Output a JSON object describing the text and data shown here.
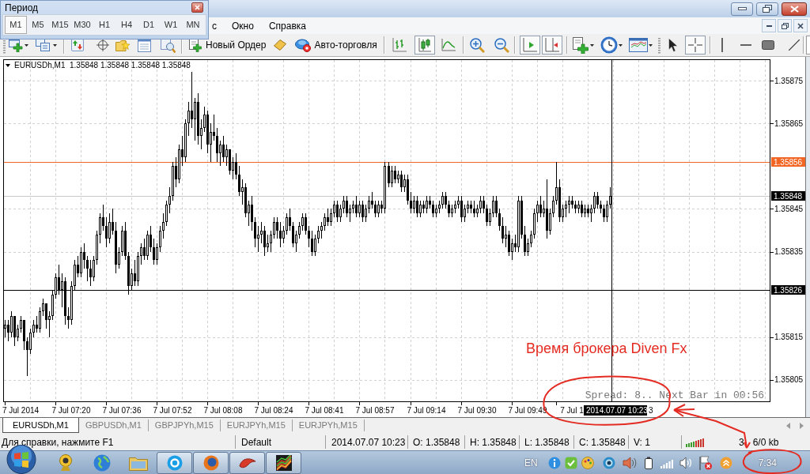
{
  "period_popup": {
    "title": "Период",
    "periods": [
      {
        "label": "M1",
        "selected": true
      },
      {
        "label": "M5",
        "selected": false
      },
      {
        "label": "M15",
        "selected": false
      },
      {
        "label": "M30",
        "selected": false
      },
      {
        "label": "H1",
        "selected": false
      },
      {
        "label": "H4",
        "selected": false
      },
      {
        "label": "D1",
        "selected": false
      },
      {
        "label": "W1",
        "selected": false
      },
      {
        "label": "MN",
        "selected": false
      }
    ]
  },
  "menu": {
    "items": [
      "с",
      "Окно",
      "Справка"
    ]
  },
  "toolbar": {
    "order_button": "Новый Ордер",
    "autotrade_button": "Авто-торговля",
    "chart_types": [
      {
        "selected": false
      },
      {
        "selected": true
      },
      {
        "selected": false
      }
    ],
    "auto_scroll": {
      "on": true
    },
    "chart_shift": {
      "on": true
    },
    "cursor_modes": [
      {
        "selected": false
      },
      {
        "selected": true
      }
    ]
  },
  "chart": {
    "chart_data": [
      {
        "type": "candlestick",
        "title": "EURUSDh,M1",
        "subtitle": "1.35848 1.35848 1.35848 1.35848",
        "categories": [
          null,
          null,
          null,
          null,
          null,
          "7 Jul 2014",
          null,
          null,
          null,
          null,
          null,
          null,
          null,
          null,
          null,
          null,
          null,
          null,
          null,
          null,
          null,
          "7 Jul 07:20",
          null,
          null,
          null,
          null,
          null,
          null,
          null,
          null,
          null,
          null,
          null,
          null,
          null,
          null,
          null,
          "7 Jul 07:36",
          null,
          null,
          null,
          null,
          null,
          null,
          null,
          null,
          null,
          null,
          null,
          null,
          null,
          null,
          null,
          "7 Jul 07:52",
          null,
          null,
          null,
          null,
          null,
          null,
          null,
          null,
          null,
          null,
          null,
          null,
          null,
          null,
          null,
          "7 Jul 08:08",
          null,
          null,
          null,
          null,
          null,
          null,
          null,
          null,
          null,
          null,
          null,
          null,
          null,
          null,
          null,
          "7 Jul 08:24",
          null,
          null,
          null,
          null,
          null,
          null,
          null,
          null,
          null,
          null,
          null,
          null,
          null,
          null,
          null,
          "7 Jul 08:41",
          null,
          null,
          null,
          null,
          null,
          null,
          null,
          null,
          null,
          null,
          null,
          null,
          null,
          null,
          null,
          "7 Jul 08:57",
          null,
          null,
          null,
          null,
          null,
          null,
          null,
          null,
          null,
          null,
          null,
          null,
          null,
          null,
          null,
          "7 Jul 09:14",
          null,
          null,
          null,
          null,
          null,
          null,
          null,
          null,
          null,
          null,
          null,
          null,
          null,
          null,
          null,
          "7 Jul 09:30",
          null,
          null,
          null,
          null,
          null,
          null,
          null,
          null,
          null,
          null,
          null,
          null,
          null,
          null,
          null,
          "7 Jul 09:49",
          null,
          null,
          null,
          null,
          null,
          null,
          null,
          null,
          null,
          null,
          null,
          null,
          null,
          "7 Jul 1",
          null,
          null,
          null,
          null,
          null,
          null,
          null,
          null,
          null,
          null,
          null,
          null,
          null,
          null,
          null,
          null,
          null,
          null,
          null,
          null,
          null,
          null,
          null,
          null,
          null,
          null,
          null,
          null,
          null,
          null,
          null,
          null,
          null,
          null,
          null,
          null,
          null,
          null,
          null,
          null,
          null,
          null,
          null,
          null,
          null,
          null,
          null,
          null,
          null,
          null,
          null,
          null,
          null,
          null,
          null,
          null,
          null,
          null,
          null,
          null,
          null,
          null
        ],
        "ohlc": [
          [
            1.35817,
            1.35819,
            1.35815,
            1.35818
          ],
          [
            1.35818,
            1.35819,
            1.35814,
            1.35816
          ],
          [
            1.35816,
            1.35821,
            1.35815,
            1.3582
          ],
          [
            1.3582,
            1.3582,
            1.35813,
            1.35815
          ],
          [
            1.35815,
            1.35818,
            1.35814,
            1.35817
          ],
          [
            1.35817,
            1.3582,
            1.35816,
            1.35819
          ],
          [
            1.35819,
            1.35819,
            1.35812,
            1.35814
          ],
          [
            1.35814,
            1.35815,
            1.35806,
            1.35812
          ],
          [
            1.35812,
            1.35817,
            1.35811,
            1.35816
          ],
          [
            1.35816,
            1.35819,
            1.35815,
            1.35818
          ],
          [
            1.35818,
            1.3582,
            1.35816,
            1.35817
          ],
          [
            1.35817,
            1.35822,
            1.35816,
            1.35821
          ],
          [
            1.35821,
            1.35824,
            1.3582,
            1.35823
          ],
          [
            1.35823,
            1.35823,
            1.35817,
            1.35819
          ],
          [
            1.35819,
            1.35821,
            1.35815,
            1.3582
          ],
          [
            1.3582,
            1.35826,
            1.35819,
            1.35825
          ],
          [
            1.35825,
            1.3583,
            1.35824,
            1.35829
          ],
          [
            1.35829,
            1.35832,
            1.35825,
            1.35826
          ],
          [
            1.35826,
            1.3583,
            1.35822,
            1.35828
          ],
          [
            1.35828,
            1.35829,
            1.35818,
            1.3582
          ],
          [
            1.3582,
            1.35822,
            1.35817,
            1.35819
          ],
          [
            1.35819,
            1.35828,
            1.35818,
            1.35827
          ],
          [
            1.35827,
            1.35833,
            1.35826,
            1.35832
          ],
          [
            1.35832,
            1.35834,
            1.35829,
            1.3583
          ],
          [
            1.3583,
            1.35836,
            1.35829,
            1.35835
          ],
          [
            1.35835,
            1.35837,
            1.35831,
            1.35833
          ],
          [
            1.35833,
            1.35834,
            1.35828,
            1.35831
          ],
          [
            1.35831,
            1.35833,
            1.35827,
            1.35829
          ],
          [
            1.35829,
            1.35834,
            1.35828,
            1.35833
          ],
          [
            1.35833,
            1.3584,
            1.35832,
            1.35839
          ],
          [
            1.35839,
            1.35844,
            1.35837,
            1.35843
          ],
          [
            1.35843,
            1.35846,
            1.3584,
            1.35841
          ],
          [
            1.35841,
            1.35843,
            1.35836,
            1.35838
          ],
          [
            1.35838,
            1.35844,
            1.35837,
            1.35842
          ],
          [
            1.35842,
            1.35845,
            1.35839,
            1.3584
          ],
          [
            1.3584,
            1.35842,
            1.3583,
            1.35832
          ],
          [
            1.35832,
            1.35836,
            1.35831,
            1.35835
          ],
          [
            1.35835,
            1.35841,
            1.35834,
            1.3584
          ],
          [
            1.3584,
            1.35842,
            1.35833,
            1.35834
          ],
          [
            1.35834,
            1.35835,
            1.35825,
            1.35827
          ],
          [
            1.35827,
            1.35831,
            1.35826,
            1.3583
          ],
          [
            1.3583,
            1.35833,
            1.35827,
            1.35828
          ],
          [
            1.35828,
            1.35835,
            1.35827,
            1.35834
          ],
          [
            1.35834,
            1.35837,
            1.35832,
            1.35836
          ],
          [
            1.35836,
            1.35838,
            1.35833,
            1.35834
          ],
          [
            1.35834,
            1.3584,
            1.35833,
            1.35839
          ],
          [
            1.35839,
            1.35841,
            1.35835,
            1.35836
          ],
          [
            1.35836,
            1.35838,
            1.35832,
            1.35833
          ],
          [
            1.35833,
            1.35837,
            1.35832,
            1.35836
          ],
          [
            1.35836,
            1.35841,
            1.35835,
            1.3584
          ],
          [
            1.3584,
            1.35844,
            1.35838,
            1.35842
          ],
          [
            1.35842,
            1.35847,
            1.35841,
            1.35846
          ],
          [
            1.35846,
            1.3585,
            1.35844,
            1.35848
          ],
          [
            1.35848,
            1.35856,
            1.35847,
            1.35855
          ],
          [
            1.35855,
            1.35857,
            1.3585,
            1.35852
          ],
          [
            1.35852,
            1.3586,
            1.35851,
            1.35859
          ],
          [
            1.35859,
            1.35862,
            1.35855,
            1.35857
          ],
          [
            1.35857,
            1.35866,
            1.35856,
            1.35865
          ],
          [
            1.35865,
            1.3587,
            1.35862,
            1.35868
          ],
          [
            1.35868,
            1.35877,
            1.35864,
            1.35866
          ],
          [
            1.35866,
            1.35871,
            1.35861,
            1.3587
          ],
          [
            1.3587,
            1.35872,
            1.3586,
            1.35862
          ],
          [
            1.35862,
            1.35866,
            1.35859,
            1.35864
          ],
          [
            1.35864,
            1.35869,
            1.35863,
            1.35867
          ],
          [
            1.35867,
            1.35868,
            1.35858,
            1.3586
          ],
          [
            1.3586,
            1.35865,
            1.35856,
            1.35863
          ],
          [
            1.35863,
            1.35867,
            1.35861,
            1.35862
          ],
          [
            1.35862,
            1.35864,
            1.35856,
            1.35858
          ],
          [
            1.35858,
            1.35861,
            1.35855,
            1.3586
          ],
          [
            1.3586,
            1.35862,
            1.35856,
            1.35857
          ],
          [
            1.35857,
            1.3586,
            1.35855,
            1.35859
          ],
          [
            1.35859,
            1.35859,
            1.35853,
            1.35854
          ],
          [
            1.35854,
            1.35857,
            1.35852,
            1.35856
          ],
          [
            1.35856,
            1.35858,
            1.35852,
            1.35853
          ],
          [
            1.35853,
            1.35855,
            1.35848,
            1.35849
          ],
          [
            1.35849,
            1.35852,
            1.35846,
            1.3585
          ],
          [
            1.3585,
            1.35851,
            1.35843,
            1.35844
          ],
          [
            1.35844,
            1.35847,
            1.35841,
            1.35846
          ],
          [
            1.35846,
            1.35848,
            1.3584,
            1.35842
          ],
          [
            1.35842,
            1.35843,
            1.35836,
            1.35838
          ],
          [
            1.35838,
            1.35841,
            1.35835,
            1.35839
          ],
          [
            1.35839,
            1.35842,
            1.35837,
            1.3584
          ],
          [
            1.3584,
            1.35841,
            1.35834,
            1.35836
          ],
          [
            1.35836,
            1.35839,
            1.35835,
            1.35837
          ],
          [
            1.35837,
            1.3584,
            1.35835,
            1.35839
          ],
          [
            1.35839,
            1.35843,
            1.35838,
            1.35842
          ],
          [
            1.35842,
            1.35843,
            1.35838,
            1.3584
          ],
          [
            1.3584,
            1.35842,
            1.35836,
            1.35838
          ],
          [
            1.35838,
            1.35841,
            1.35837,
            1.3584
          ],
          [
            1.3584,
            1.35844,
            1.35839,
            1.35843
          ],
          [
            1.35843,
            1.35845,
            1.3584,
            1.35841
          ],
          [
            1.35841,
            1.35842,
            1.35836,
            1.35837
          ],
          [
            1.35837,
            1.3584,
            1.35835,
            1.35839
          ],
          [
            1.35839,
            1.35842,
            1.35838,
            1.35841
          ],
          [
            1.35841,
            1.35844,
            1.3584,
            1.35843
          ],
          [
            1.35843,
            1.35844,
            1.35839,
            1.3584
          ],
          [
            1.3584,
            1.35841,
            1.35836,
            1.35838
          ],
          [
            1.35838,
            1.3584,
            1.35834,
            1.35835
          ],
          [
            1.35835,
            1.35839,
            1.35834,
            1.35838
          ],
          [
            1.35838,
            1.35841,
            1.35837,
            1.3584
          ],
          [
            1.3584,
            1.35842,
            1.35838,
            1.35841
          ],
          [
            1.35841,
            1.35844,
            1.3584,
            1.35843
          ],
          [
            1.35843,
            1.35845,
            1.35841,
            1.35842
          ],
          [
            1.35842,
            1.35845,
            1.35841,
            1.35844
          ],
          [
            1.35844,
            1.35847,
            1.35843,
            1.35846
          ],
          [
            1.35846,
            1.35847,
            1.35842,
            1.35843
          ],
          [
            1.35843,
            1.35846,
            1.35842,
            1.35845
          ],
          [
            1.35845,
            1.35848,
            1.35844,
            1.35847
          ],
          [
            1.35847,
            1.35848,
            1.35843,
            1.35844
          ],
          [
            1.35844,
            1.35846,
            1.35842,
            1.35845
          ],
          [
            1.35845,
            1.35847,
            1.35844,
            1.35846
          ],
          [
            1.35846,
            1.35848,
            1.35843,
            1.35844
          ],
          [
            1.35844,
            1.35847,
            1.35843,
            1.35846
          ],
          [
            1.35846,
            1.35847,
            1.35842,
            1.35843
          ],
          [
            1.35843,
            1.35846,
            1.35842,
            1.35845
          ],
          [
            1.35845,
            1.35848,
            1.35844,
            1.35847
          ],
          [
            1.35847,
            1.35849,
            1.35845,
            1.35846
          ],
          [
            1.35846,
            1.35847,
            1.35843,
            1.35844
          ],
          [
            1.35844,
            1.35847,
            1.35843,
            1.35846
          ],
          [
            1.35846,
            1.35847,
            1.35844,
            1.35845
          ],
          [
            1.35845,
            1.35856,
            1.35844,
            1.35855
          ],
          [
            1.35855,
            1.35856,
            1.3585,
            1.35851
          ],
          [
            1.35851,
            1.35855,
            1.3585,
            1.35854
          ],
          [
            1.35854,
            1.35855,
            1.35851,
            1.35852
          ],
          [
            1.35852,
            1.35854,
            1.35851,
            1.35853
          ],
          [
            1.35853,
            1.35854,
            1.35849,
            1.3585
          ],
          [
            1.3585,
            1.35853,
            1.35849,
            1.35852
          ],
          [
            1.35852,
            1.35853,
            1.35846,
            1.35847
          ],
          [
            1.35847,
            1.35849,
            1.35844,
            1.35845
          ],
          [
            1.35845,
            1.35848,
            1.35844,
            1.35847
          ],
          [
            1.35847,
            1.35848,
            1.35843,
            1.35844
          ],
          [
            1.35844,
            1.35847,
            1.35843,
            1.35846
          ],
          [
            1.35846,
            1.35847,
            1.35844,
            1.35845
          ],
          [
            1.35845,
            1.35848,
            1.35844,
            1.35847
          ],
          [
            1.35847,
            1.35848,
            1.35845,
            1.35846
          ],
          [
            1.35846,
            1.35847,
            1.35843,
            1.35844
          ],
          [
            1.35844,
            1.35846,
            1.35843,
            1.35845
          ],
          [
            1.35845,
            1.35847,
            1.35844,
            1.35846
          ],
          [
            1.35846,
            1.35849,
            1.35845,
            1.35848
          ],
          [
            1.35848,
            1.35849,
            1.35845,
            1.35846
          ],
          [
            1.35846,
            1.35847,
            1.35843,
            1.35844
          ],
          [
            1.35844,
            1.35846,
            1.35843,
            1.35845
          ],
          [
            1.35845,
            1.35847,
            1.35844,
            1.35846
          ],
          [
            1.35846,
            1.35848,
            1.35845,
            1.35847
          ],
          [
            1.35847,
            1.35848,
            1.35842,
            1.35843
          ],
          [
            1.35843,
            1.35846,
            1.35842,
            1.35845
          ],
          [
            1.35845,
            1.35847,
            1.35844,
            1.35846
          ],
          [
            1.35846,
            1.35847,
            1.35844,
            1.35845
          ],
          [
            1.35845,
            1.35847,
            1.35843,
            1.35844
          ],
          [
            1.35844,
            1.35846,
            1.35843,
            1.35845
          ],
          [
            1.35845,
            1.35848,
            1.35844,
            1.35847
          ],
          [
            1.35847,
            1.35848,
            1.35844,
            1.35845
          ],
          [
            1.35845,
            1.35846,
            1.35841,
            1.35842
          ],
          [
            1.35842,
            1.35845,
            1.35841,
            1.35844
          ],
          [
            1.35844,
            1.35848,
            1.35843,
            1.35847
          ],
          [
            1.35847,
            1.35848,
            1.35843,
            1.35844
          ],
          [
            1.35844,
            1.35845,
            1.3584,
            1.35841
          ],
          [
            1.35841,
            1.35843,
            1.35837,
            1.35838
          ],
          [
            1.35838,
            1.35841,
            1.35836,
            1.35839
          ],
          [
            1.35839,
            1.3584,
            1.35834,
            1.35835
          ],
          [
            1.35835,
            1.35838,
            1.35833,
            1.35837
          ],
          [
            1.35837,
            1.35839,
            1.35835,
            1.35836
          ],
          [
            1.35836,
            1.35848,
            1.35835,
            1.35847
          ],
          [
            1.35847,
            1.35848,
            1.35838,
            1.35839
          ],
          [
            1.35839,
            1.35841,
            1.35834,
            1.35835
          ],
          [
            1.35835,
            1.35838,
            1.35834,
            1.35837
          ],
          [
            1.35837,
            1.3584,
            1.35836,
            1.35839
          ],
          [
            1.35839,
            1.35845,
            1.35838,
            1.35844
          ],
          [
            1.35844,
            1.35847,
            1.35842,
            1.35846
          ],
          [
            1.35846,
            1.35848,
            1.35843,
            1.35844
          ],
          [
            1.35844,
            1.35847,
            1.35843,
            1.35845
          ],
          [
            1.35845,
            1.35852,
            1.35838,
            1.3584
          ],
          [
            1.3584,
            1.35845,
            1.35839,
            1.35844
          ],
          [
            1.35844,
            1.35848,
            1.35843,
            1.35847
          ],
          [
            1.35847,
            1.35856,
            1.35846,
            1.3585
          ],
          [
            1.3585,
            1.35852,
            1.35842,
            1.35843
          ],
          [
            1.35843,
            1.35846,
            1.35842,
            1.35845
          ],
          [
            1.35845,
            1.35847,
            1.35843,
            1.35846
          ],
          [
            1.35846,
            1.35848,
            1.35844,
            1.35847
          ],
          [
            1.35847,
            1.35848,
            1.35845,
            1.35846
          ],
          [
            1.35846,
            1.35847,
            1.35844,
            1.35845
          ],
          [
            1.35845,
            1.35847,
            1.35844,
            1.35846
          ],
          [
            1.35846,
            1.35847,
            1.35843,
            1.35844
          ],
          [
            1.35844,
            1.35846,
            1.35843,
            1.35845
          ],
          [
            1.35845,
            1.35846,
            1.35843,
            1.35844
          ],
          [
            1.35844,
            1.35846,
            1.35842,
            1.35845
          ],
          [
            1.35845,
            1.35849,
            1.35844,
            1.35848
          ],
          [
            1.35848,
            1.35849,
            1.35845,
            1.35846
          ],
          [
            1.35846,
            1.35847,
            1.35844,
            1.35845
          ],
          [
            1.35845,
            1.35846,
            1.35842,
            1.35843
          ],
          [
            1.35843,
            1.35847,
            1.35842,
            1.35846
          ],
          [
            1.35846,
            1.3585,
            1.35845,
            1.35848
          ],
          null,
          null,
          null,
          null,
          null,
          null,
          null,
          null,
          null,
          null,
          null,
          null,
          null,
          null,
          null,
          null,
          null,
          null,
          null,
          null,
          null,
          null,
          null,
          null,
          null,
          null,
          null,
          null,
          null,
          null,
          null,
          null,
          null,
          null,
          null,
          null,
          null,
          null,
          null,
          null,
          null,
          null,
          null,
          null,
          null,
          null,
          null,
          null,
          null,
          null
        ],
        "ylim": [
          1.358,
          1.3588
        ],
        "yticks": [
          {
            "value": 1.35805,
            "label": "1.35805"
          },
          {
            "value": 1.35815,
            "label": "1.35815"
          },
          {
            "value": 1.35835,
            "label": "1.35835"
          },
          {
            "value": 1.35845,
            "label": "1.35845"
          },
          {
            "value": 1.35865,
            "label": "1.35865"
          },
          {
            "value": 1.35875,
            "label": "1.35875"
          }
        ],
        "grid": true,
        "ref_lines": [
          {
            "axis": "y",
            "value": 1.35856,
            "label": "1.35856",
            "color": "#f26522"
          },
          {
            "axis": "y",
            "value": 1.35848,
            "label": "1.35848",
            "color": "#c8c8c8"
          },
          {
            "axis": "y",
            "value": 1.35826,
            "label": "1.35826",
            "color": "#000000"
          }
        ],
        "annotations": [
          "Spread: 8.. Next Bar in 00:56"
        ]
      }
    ],
    "crosshair_time": "2014.07.07 10:23",
    "axis_fragment": "3"
  },
  "chart_tabs": [
    {
      "label": "EURUSDh,M1",
      "selected": true
    },
    {
      "label": "GBPUSDh,M1",
      "selected": false
    },
    {
      "label": "GBPJPYh,M15",
      "selected": false
    },
    {
      "label": "EURJPYh,M15",
      "selected": false
    },
    {
      "label": "EURJPYh,M15",
      "selected": false
    }
  ],
  "status_bar": {
    "texts": [
      "Для справки, нажмите F1",
      "Default",
      "2014.07.07 10:23",
      "O: 1.35848",
      "H: 1.35848",
      "L: 1.35848",
      "C: 1.35848",
      "V: 1"
    ],
    "traffic": [
      "3",
      "6/0 kb"
    ]
  },
  "taskbar": {
    "apps": [
      {
        "running": false
      },
      {
        "running": false
      },
      {
        "running": false
      },
      {
        "running": true
      },
      {
        "running": true
      },
      {
        "running": true
      },
      {
        "running": true
      }
    ],
    "language": "EN",
    "clock": "7:34"
  },
  "markup": {
    "note": "Время брокера Diven Fx"
  }
}
